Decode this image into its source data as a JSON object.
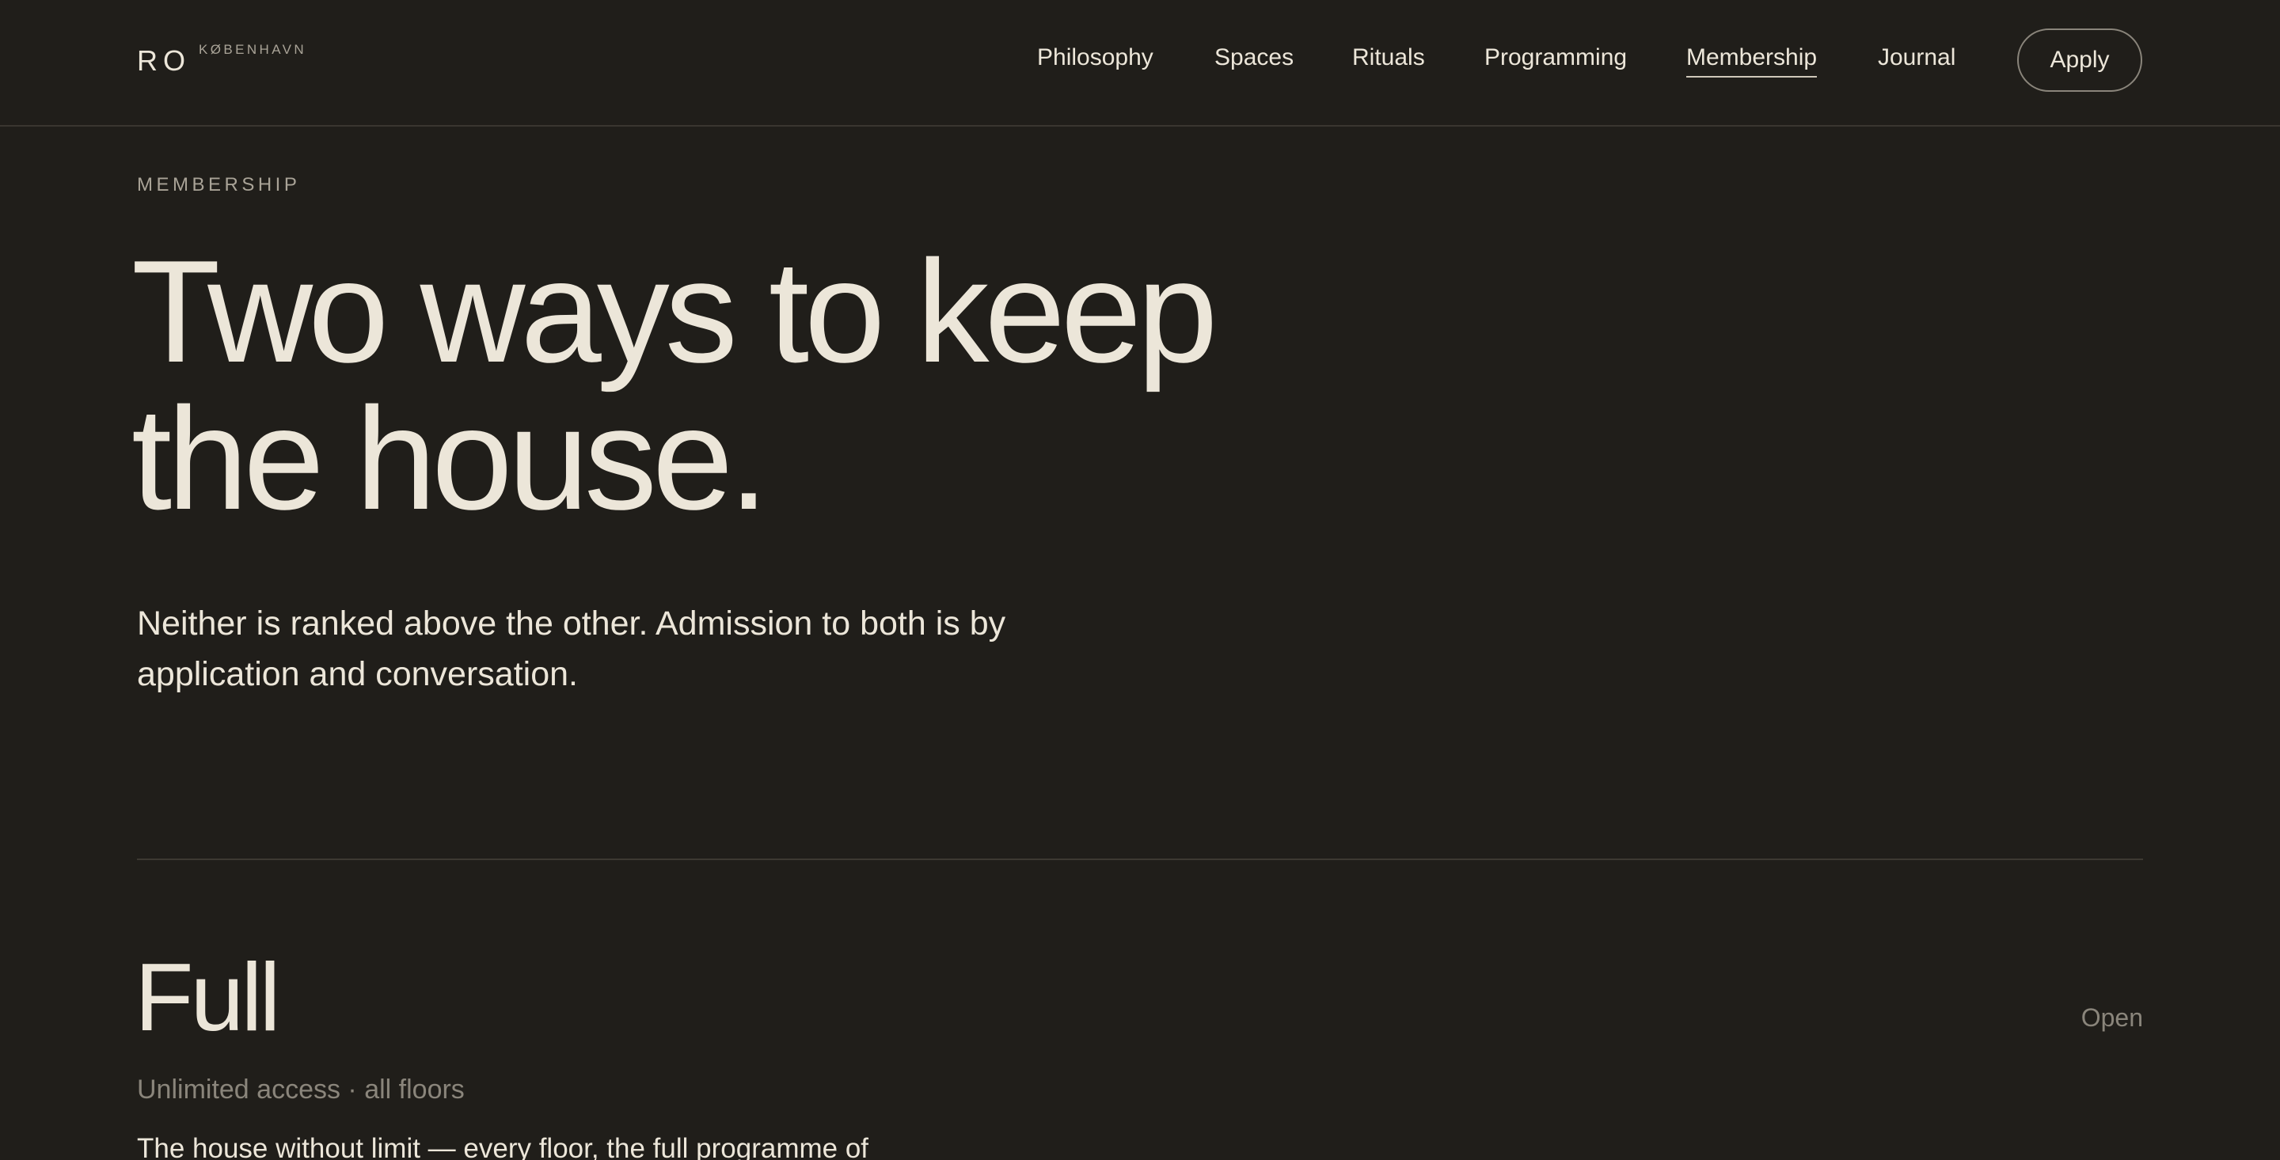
{
  "brand": {
    "name": "RO",
    "city": "KØBENHAVN"
  },
  "nav": {
    "items": [
      {
        "label": "Philosophy"
      },
      {
        "label": "Spaces"
      },
      {
        "label": "Rituals"
      },
      {
        "label": "Programming"
      },
      {
        "label": "Membership",
        "active": true
      },
      {
        "label": "Journal"
      }
    ],
    "apply_label": "Apply"
  },
  "hero": {
    "eyebrow": "MEMBERSHIP",
    "headline_line1": "Two ways to keep",
    "headline_line2": "the house.",
    "intro": "Neither is ranked above the other. Admission to both is by application and conversation."
  },
  "tier": {
    "title": "Full",
    "status": "Open",
    "subtitle": "Unlimited access · all floors",
    "description": "The house without limit — every floor, the full programme of"
  },
  "colors": {
    "background": "#201e1a",
    "text": "#ece6d9",
    "muted": "#8a857b",
    "rule": "#3d3932"
  }
}
